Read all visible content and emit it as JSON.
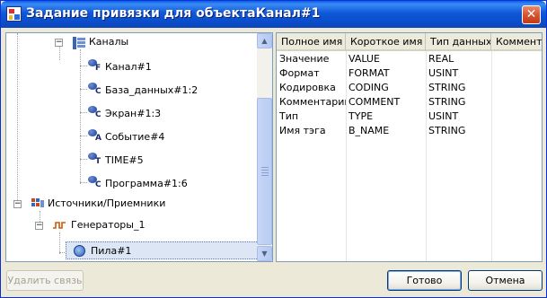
{
  "window": {
    "title": "Задание привязки для объектаКанал#1",
    "close_label": "✕"
  },
  "tree": {
    "channels_label": "Каналы",
    "channels_expander": "−",
    "channel_items": [
      {
        "label": "Канал#1",
        "subscript": "F"
      },
      {
        "label": "База_данных#1:2",
        "subscript": "C"
      },
      {
        "label": "Экран#1:3",
        "subscript": "C"
      },
      {
        "label": "Событие#4",
        "subscript": "A"
      },
      {
        "label": "TIME#5",
        "subscript": "T"
      },
      {
        "label": "Программа#1:6",
        "subscript": "C"
      }
    ],
    "sources_label": "Источники/Приемники",
    "sources_expander": "−",
    "generators_label": "Генераторы_1",
    "generators_expander": "−",
    "selected_label": "Пила#1"
  },
  "scrollbar": {
    "up_arrow": "▲",
    "down_arrow": "▼"
  },
  "grid": {
    "columns": [
      "Полное имя",
      "Короткое имя",
      "Тип данных",
      "Коммент"
    ],
    "rows": [
      [
        "Значение",
        "VALUE",
        "REAL"
      ],
      [
        "Формат",
        "FORMAT",
        "USINT"
      ],
      [
        "Кодировка",
        "CODING",
        "STRING"
      ],
      [
        "Комментарий",
        "COMMENT",
        "STRING"
      ],
      [
        "Тип",
        "TYPE",
        "USINT"
      ],
      [
        "Имя тэга",
        "B_NAME",
        "STRING"
      ]
    ]
  },
  "buttons": {
    "remove_link": "Удалить связь",
    "ok": "Готово",
    "cancel": "Отмена"
  }
}
